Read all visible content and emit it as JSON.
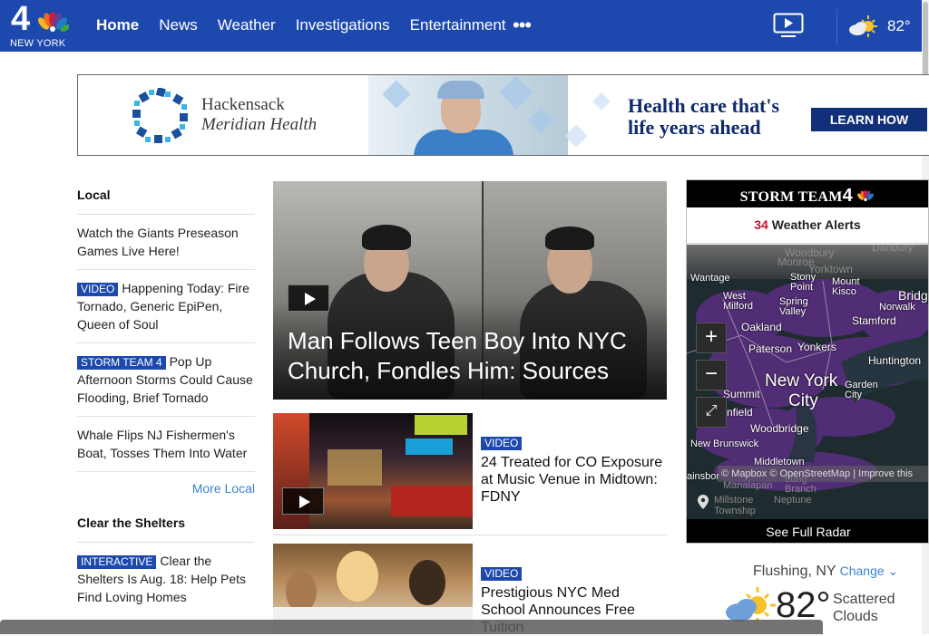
{
  "nav": {
    "logo_number": "4",
    "logo_city": "NEW YORK",
    "links": [
      "Home",
      "News",
      "Weather",
      "Investigations",
      "Entertainment"
    ],
    "more": "•••",
    "temp": "82°"
  },
  "ad": {
    "brand_line1": "Hackensack",
    "brand_line2": "Meridian Health",
    "tagline_line1": "Health care that's",
    "tagline_line2": "life years ahead",
    "cta": "LEARN HOW"
  },
  "left": {
    "local_title": "Local",
    "local_stories": [
      {
        "badge": "",
        "text": "Watch the Giants Preseason Games Live Here!"
      },
      {
        "badge": "VIDEO",
        "text": "Happening Today: Fire Tornado, Generic EpiPen, Queen of Soul"
      },
      {
        "badge": "STORM TEAM 4",
        "text": "Pop Up Afternoon Storms Could Cause Flooding, Brief Tornado"
      },
      {
        "badge": "",
        "text": "Whale Flips NJ Fishermen's Boat, Tosses Them Into Water"
      }
    ],
    "more_local": "More Local",
    "shelters_title": "Clear the Shelters",
    "shelters_story": {
      "badge": "INTERACTIVE",
      "text": "Clear the Shelters Is Aug. 18: Help Pets Find Loving Homes"
    }
  },
  "center": {
    "hero_headline": "Man Follows Teen Boy Into NYC Church, Fondles Him: Sources",
    "cards": [
      {
        "badge": "VIDEO",
        "title": "24 Treated for CO Exposure at Music Venue in Midtown: FDNY"
      },
      {
        "badge": "VIDEO",
        "title": "Prestigious NYC Med School Announces Free Tuition"
      }
    ]
  },
  "storm": {
    "title": "STORM TEAM",
    "title_number": "4",
    "alert_count": "34",
    "alert_label": "Weather Alerts",
    "map_labels": {
      "woodbury": "Woodbury",
      "monroe": "Monroe",
      "yorktown": "Yorktown",
      "danbury": "Danbury",
      "wantage": "Wantage",
      "stony_point": "Stony Point",
      "mount_kisco": "Mount Kisco",
      "bridgeport": "Bridg",
      "west_milford": "West Milford",
      "spring_valley": "Spring Valley",
      "norwalk": "Norwalk",
      "stamford": "Stamford",
      "oakland": "Oakland",
      "paterson": "Paterson",
      "yonkers": "Yonkers",
      "huntington": "Huntington",
      "new_york": "New York",
      "city": "City",
      "garden_city": "Garden City",
      "summit": "Summit",
      "plainfield": "nfield",
      "woodbridge": "Woodbridge",
      "new_brunswick": "New Brunswick",
      "middletown": "Middletown",
      "plainsboro": "ainsbor",
      "manalapan": "Manalapan",
      "long_branch": "Long Branch",
      "millstone": "Millstone",
      "township": "Township",
      "neptune": "Neptune"
    },
    "attribution": "© Mapbox © OpenStreetMap | Improve this",
    "see_radar": "See Full Radar"
  },
  "weather": {
    "location": "Flushing, NY",
    "change": "Change ⌄",
    "temp": "82°",
    "cond_line1": "Scattered",
    "cond_line2": "Clouds"
  },
  "colors": {
    "nav_blue": "#1d48ad",
    "badge_blue": "#1d48ad",
    "link_blue": "#3b82d1",
    "alert_red": "#c8102e"
  }
}
